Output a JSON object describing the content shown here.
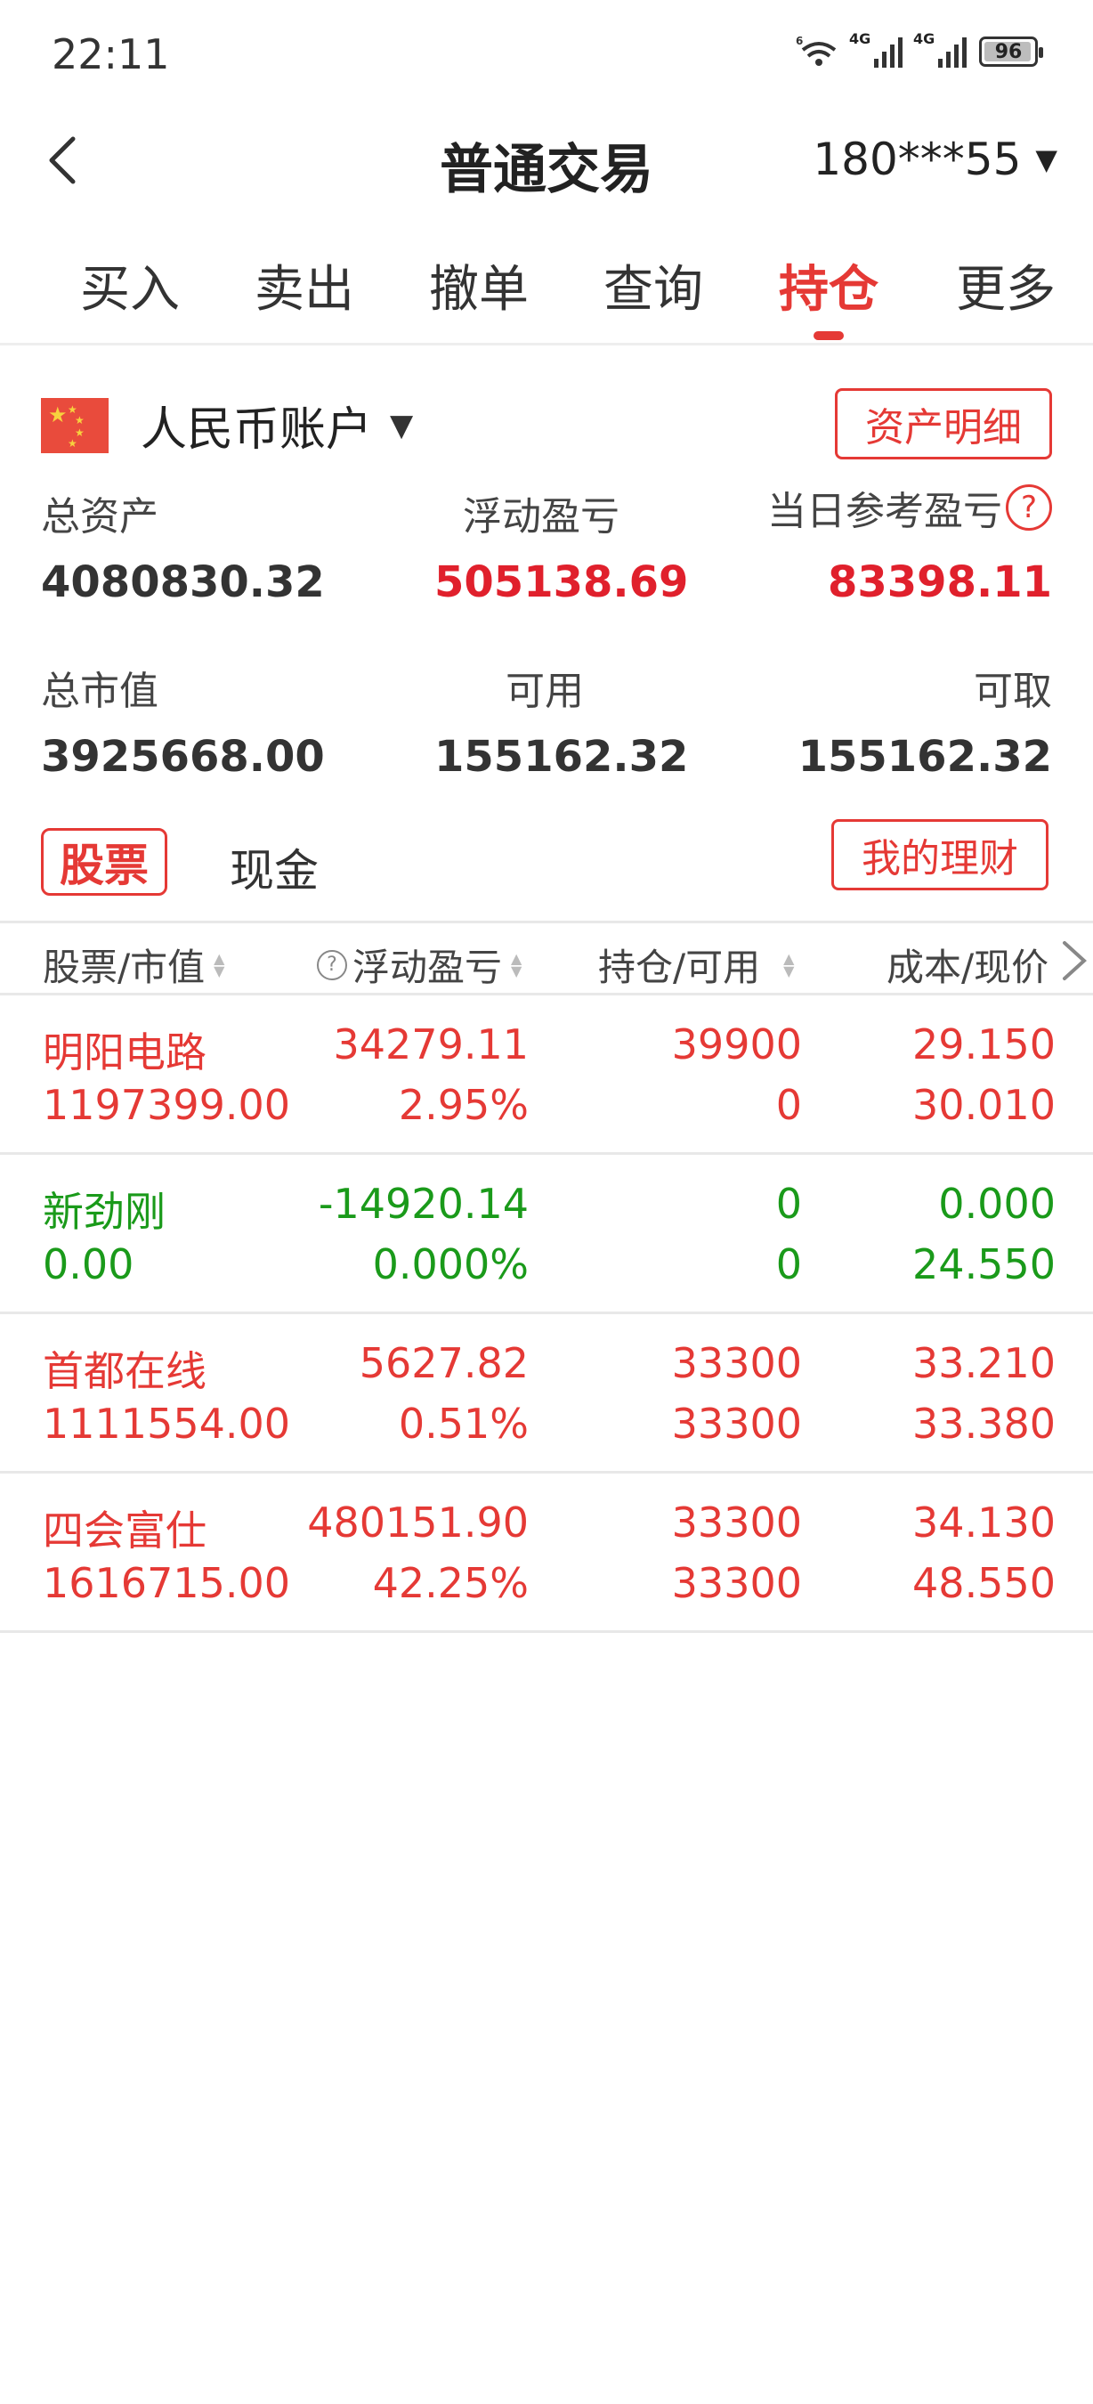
{
  "status_bar": {
    "time": "22:11",
    "net1": "6",
    "net2": "4G",
    "net3": "4G",
    "battery": "96"
  },
  "header": {
    "title": "普通交易",
    "account": "180***55"
  },
  "tabs": [
    {
      "label": "买入",
      "active": false
    },
    {
      "label": "卖出",
      "active": false
    },
    {
      "label": "撤单",
      "active": false
    },
    {
      "label": "查询",
      "active": false
    },
    {
      "label": "持仓",
      "active": true
    },
    {
      "label": "更多",
      "active": false
    }
  ],
  "account_panel": {
    "currency_account": "人民币账户",
    "asset_detail_button": "资产明细",
    "total_assets_label": "总资产",
    "total_assets": "4080830.32",
    "floating_pl_label": "浮动盈亏",
    "floating_pl": "505138.69",
    "daily_pl_label": "当日参考盈亏",
    "daily_pl": "83398.11",
    "market_value_label": "总市值",
    "market_value": "3925668.00",
    "available_label": "可用",
    "available": "155162.32",
    "withdrawable_label": "可取",
    "withdrawable": "155162.32"
  },
  "sub_tabs": {
    "stocks": "股票",
    "cash": "现金",
    "wealth_button": "我的理财"
  },
  "table": {
    "headers": [
      "股票/市值",
      "浮动盈亏",
      "持仓/可用",
      "成本/现价"
    ],
    "rows": [
      {
        "name": "明阳电路",
        "market_value": "1197399.00",
        "pl": "34279.11",
        "pl_pct": "2.95%",
        "position": "39900",
        "available": "0",
        "cost": "29.150",
        "price": "30.010",
        "trend": "up"
      },
      {
        "name": "新劲刚",
        "market_value": "0.00",
        "pl": "-14920.14",
        "pl_pct": "0.000%",
        "position": "0",
        "available": "0",
        "cost": "0.000",
        "price": "24.550",
        "trend": "down"
      },
      {
        "name": "首都在线",
        "market_value": "1111554.00",
        "pl": "5627.82",
        "pl_pct": "0.51%",
        "position": "33300",
        "available": "33300",
        "cost": "33.210",
        "price": "33.380",
        "trend": "up"
      },
      {
        "name": "四会富仕",
        "market_value": "1616715.00",
        "pl": "480151.90",
        "pl_pct": "42.25%",
        "position": "33300",
        "available": "33300",
        "cost": "34.130",
        "price": "48.550",
        "trend": "up"
      }
    ]
  },
  "colors": {
    "accent": "#e53935",
    "down": "#1a9a1a"
  }
}
